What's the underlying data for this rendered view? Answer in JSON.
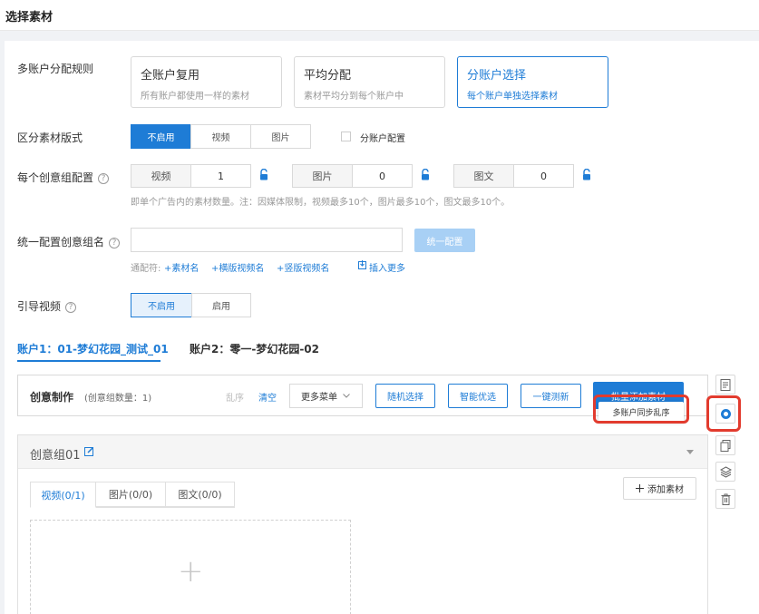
{
  "header": {
    "title": "选择素材"
  },
  "rule": {
    "label": "多账户分配规则",
    "options": [
      {
        "title": "全账户复用",
        "desc": "所有账户都使用一样的素材"
      },
      {
        "title": "平均分配",
        "desc": "素材平均分到每个账户中"
      },
      {
        "title": "分账户选择",
        "desc": "每个账户单独选择素材"
      }
    ]
  },
  "format": {
    "label": "区分素材版式",
    "options": [
      "不启用",
      "视频",
      "图片"
    ],
    "checkbox_label": "分账户配置"
  },
  "group_config": {
    "label": "每个创意组配置",
    "help": "?",
    "items": [
      {
        "key": "视频",
        "value": "1"
      },
      {
        "key": "图片",
        "value": "0"
      },
      {
        "key": "图文",
        "value": "0"
      }
    ],
    "hint": "即单个广告内的素材数量。注：因媒体限制，视频最多10个，图片最多10个，图文最多10个。"
  },
  "name_config": {
    "label": "统一配置创意组名",
    "help": "?",
    "button": "统一配置",
    "wildcard_label": "通配符:",
    "wildcards": [
      "+素材名",
      "+横版视频名",
      "+竖版视频名"
    ],
    "insert_more": "插入更多"
  },
  "guide_video": {
    "label": "引导视频",
    "help": "?",
    "options": [
      "不启用",
      "启用"
    ]
  },
  "account_tabs": [
    "账户1：01-梦幻花园_测试_01",
    "账户2：零一-梦幻花园-02"
  ],
  "creative": {
    "title": "创意制作",
    "count": "(创意组数量：1)",
    "shuffle": "乱序",
    "clear": "清空",
    "more_menu": "更多菜单",
    "random": "随机选择",
    "smart": "智能优选",
    "onekey": "一键测新",
    "batch_add": "批量添加素材",
    "popover": "多账户同步乱序"
  },
  "group": {
    "title": "创意组01",
    "tabs": [
      "视频(0/1)",
      "图片(0/0)",
      "图文(0/0)"
    ],
    "add_button": "添加素材",
    "plus": "+"
  },
  "colors": {
    "accent": "#1e7cd6",
    "highlight": "#e23b2e"
  }
}
